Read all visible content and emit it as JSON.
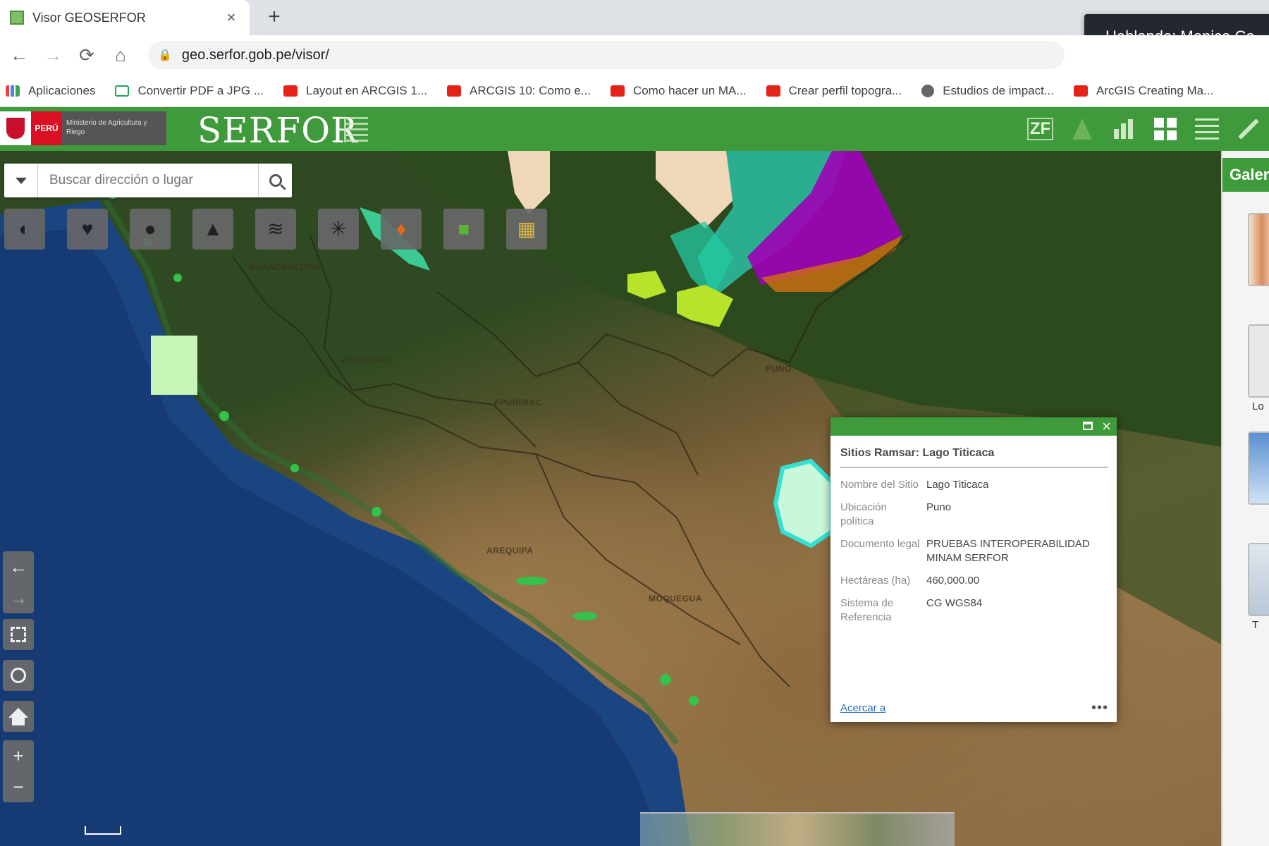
{
  "browser": {
    "tab_title": "Visor GEOSERFOR",
    "tab_close": "×",
    "new_tab": "+",
    "url": "geo.serfor.gob.pe/visor/",
    "bookmarks": [
      {
        "label": "Aplicaciones",
        "icon": "apps-icon"
      },
      {
        "label": "Convertir PDF a JPG ...",
        "icon": "pdf-icon"
      },
      {
        "label": "Layout en ARCGIS 1...",
        "icon": "youtube-icon"
      },
      {
        "label": "ARCGIS 10: Como e...",
        "icon": "youtube-icon"
      },
      {
        "label": "Como hacer un MA...",
        "icon": "youtube-icon"
      },
      {
        "label": "Crear perfil topogra...",
        "icon": "youtube-icon"
      },
      {
        "label": "Estudios de impact...",
        "icon": "globe-icon"
      },
      {
        "label": "ArcGIS Creating Ma...",
        "icon": "youtube-icon"
      }
    ]
  },
  "toast": "Hablando: Monica Co",
  "header": {
    "gov_peru": "PERÚ",
    "gov_ministry": "Ministerio de Agricultura y Riego",
    "logo": "SERFOR",
    "zf_label": "ZF",
    "accent_color": "#3e9a3a"
  },
  "search": {
    "placeholder": "Buscar dirección o lugar"
  },
  "map_labels": [
    {
      "text": "HUANCAVELICA"
    },
    {
      "text": "AYACUCHO"
    },
    {
      "text": "APURIMAC"
    },
    {
      "text": "PUNO"
    },
    {
      "text": "AREQUIPA"
    },
    {
      "text": "MOQUEGUA"
    }
  ],
  "popup": {
    "title": "Sitios Ramsar: Lago Titicaca",
    "close": "×",
    "rows": [
      {
        "key": "Nombre del Sitio",
        "value": "Lago Titicaca"
      },
      {
        "key": "Ubicación política",
        "value": "Puno"
      },
      {
        "key": "Documento legal",
        "value": "PRUEBAS INTEROPERABILIDAD MINAM SERFOR"
      },
      {
        "key": "Hectáreas (ha)",
        "value": "460,000.00"
      },
      {
        "key": "Sistema de Referencia",
        "value": "CG WGS84"
      }
    ],
    "zoom_link": "Acercar a",
    "more": "•••"
  },
  "gallery": {
    "title": "Galería",
    "captions": [
      "Lo",
      "T"
    ]
  }
}
